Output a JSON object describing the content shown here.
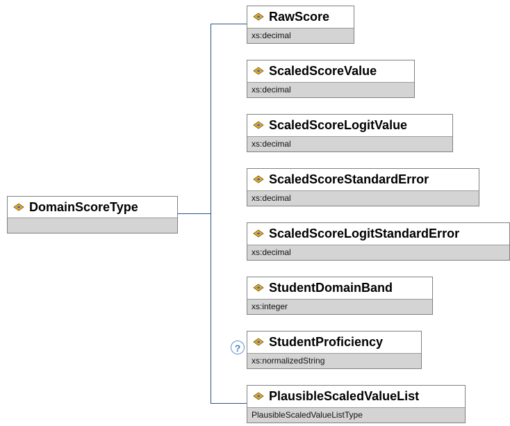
{
  "root": {
    "name": "DomainScoreType",
    "type": ""
  },
  "children": [
    {
      "name": "RawScore",
      "type": "xs:decimal"
    },
    {
      "name": "ScaledScoreValue",
      "type": "xs:decimal"
    },
    {
      "name": "ScaledScoreLogitValue",
      "type": "xs:decimal"
    },
    {
      "name": "ScaledScoreStandardError",
      "type": "xs:decimal"
    },
    {
      "name": "ScaledScoreLogitStandardError",
      "type": "xs:decimal"
    },
    {
      "name": "StudentDomainBand",
      "type": "xs:integer"
    },
    {
      "name": "StudentProficiency",
      "type": "xs:normalizedString",
      "optional_marker": "?"
    },
    {
      "name": "PlausibleScaledValueList",
      "type": "PlausibleScaledValueListType"
    }
  ],
  "colors": {
    "connector": "#2d4f86",
    "box_border": "#7f7f7f",
    "type_bar": "#d4d4d4"
  }
}
